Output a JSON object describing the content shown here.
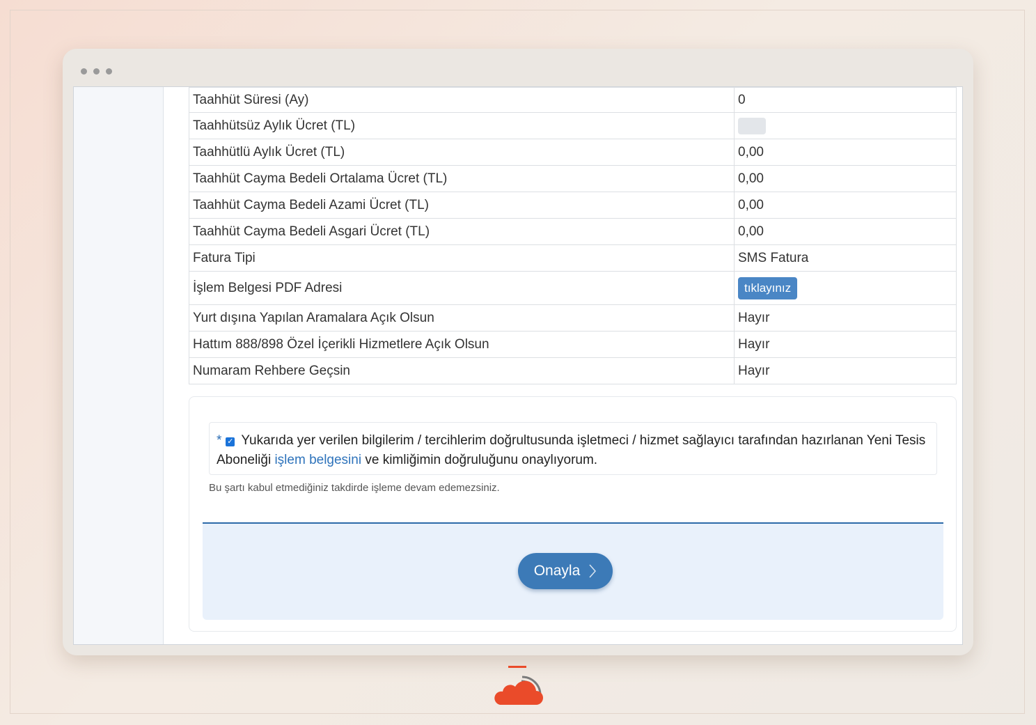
{
  "rows": [
    {
      "label": "Taahhüt Süresi (Ay)",
      "value": "0"
    },
    {
      "label": "Taahhütsüz Aylık Ücret (TL)",
      "value": ""
    },
    {
      "label": "Taahhütlü Aylık Ücret (TL)",
      "value": "0,00"
    },
    {
      "label": "Taahhüt Cayma Bedeli Ortalama Ücret (TL)",
      "value": "0,00"
    },
    {
      "label": "Taahhüt Cayma Bedeli Azami Ücret (TL)",
      "value": "0,00"
    },
    {
      "label": "Taahhüt Cayma Bedeli Asgari Ücret (TL)",
      "value": "0,00"
    },
    {
      "label": "Fatura Tipi",
      "value": "SMS Fatura"
    },
    {
      "label": "İşlem Belgesi PDF Adresi",
      "button": "tıklayınız"
    },
    {
      "label": "Yurt dışına Yapılan Aramalara Açık Olsun",
      "value": "Hayır"
    },
    {
      "label": "Hattım 888/898 Özel İçerikli Hizmetlere Açık Olsun",
      "value": "Hayır"
    },
    {
      "label": "Numaram Rehbere Geçsin",
      "value": "Hayır"
    }
  ],
  "consent": {
    "required_mark": "*",
    "text_before": "Yukarıda yer verilen bilgilerim / tercihlerim doğrultusunda işletmeci / hizmet sağlayıcı tarafından hazırlanan Yeni Tesis Aboneliği ",
    "link_text": "işlem belgesini",
    "text_after": " ve kimliğimin doğruluğunu onaylıyorum.",
    "checked": true,
    "note": "Bu şartı kabul etmediğiniz takdirde işleme devam edemezsiniz."
  },
  "confirm_button": {
    "label": "Onayla",
    "icon": "chevron-right-icon"
  },
  "colors": {
    "accent": "#3c7ab7",
    "button_small": "#4a86c5",
    "action_bg": "#e9f1fb",
    "logo": "#ea4b2a"
  }
}
